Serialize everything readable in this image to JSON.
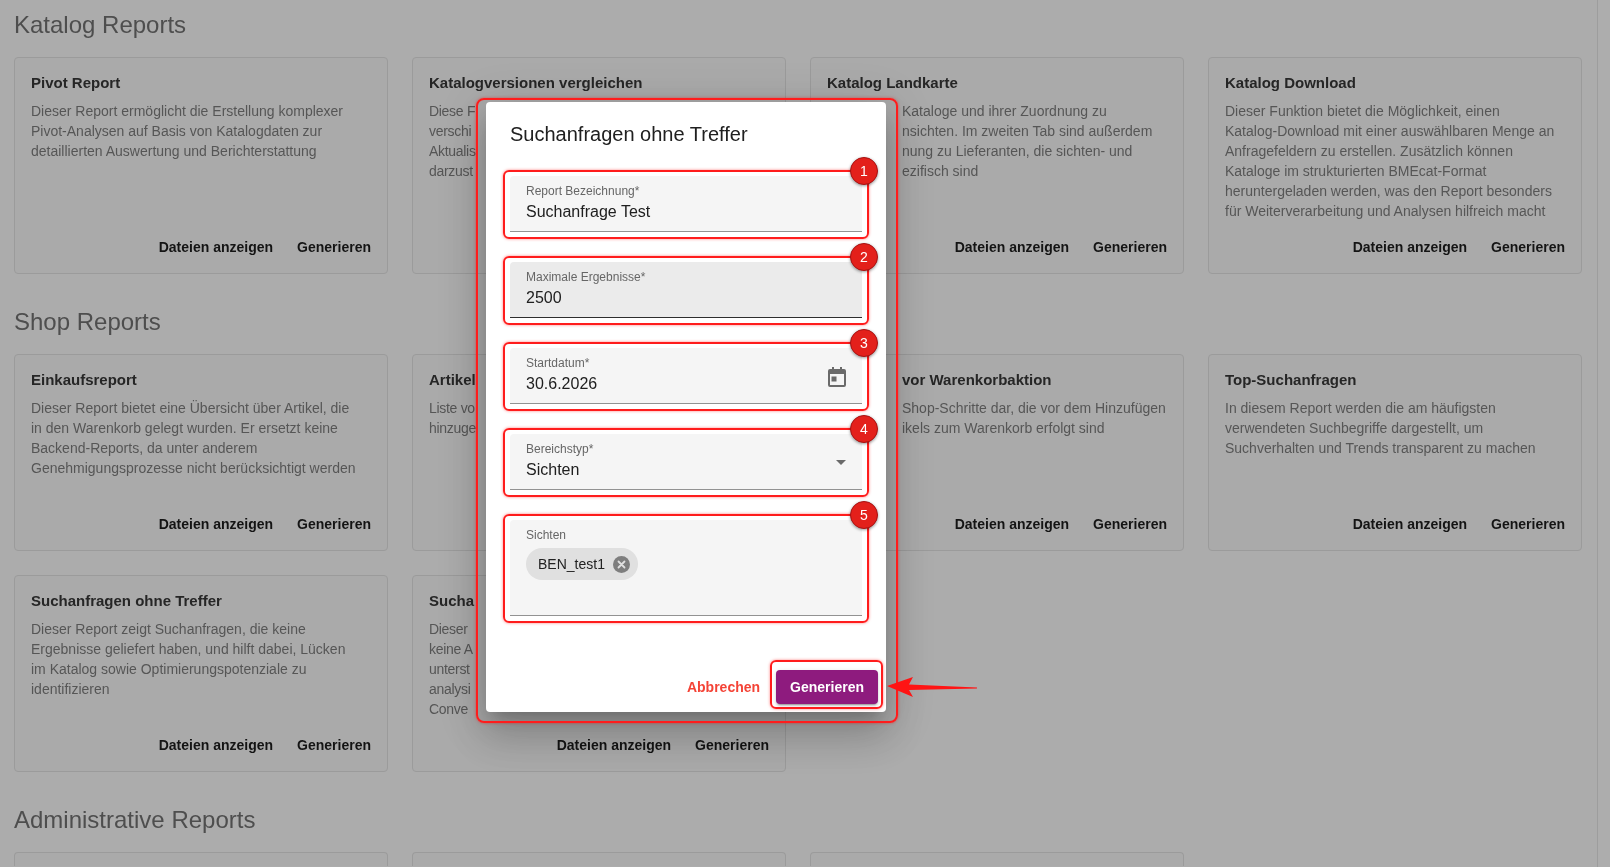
{
  "sections": [
    {
      "title": "Katalog Reports",
      "cards": [
        {
          "kind": "full",
          "title": "Pivot Report",
          "description": "Dieser Report ermöglicht die Erstellung komplexer Pivot-Analysen auf Basis von Katalogdaten zur detaillierten Auswertung und Berichterstattung",
          "actions": [
            "Dateien anzeigen",
            "Generieren"
          ]
        },
        {
          "kind": "hidden_right",
          "title": "Katalogversionen vergleichen",
          "description_lines": [
            "Diese F",
            "verschi",
            "Aktualis",
            "darzust"
          ]
        },
        {
          "kind": "hidden_left",
          "title": "Katalog Landkarte",
          "title_cut": false,
          "description_lines": [
            "Kataloge und ihrer Zuordnung zu",
            "nsichten. Im zweiten Tab sind außerdem",
            "nung zu Lieferanten, die sichten- und",
            "ezifisch sind"
          ],
          "actions": [
            "Dateien anzeigen",
            "Generieren"
          ]
        },
        {
          "kind": "full",
          "title": "Katalog Download",
          "description": "Dieser Funktion bietet die Möglichkeit, einen Katalog-Download mit einer auswählbaren Menge an Anfragefeldern zu erstellen. Zusätzlich können Kataloge im strukturierten BMEcat-Format heruntergeladen werden, was den Report besonders für Weiterverarbeitung und Analysen hilfreich macht",
          "actions": [
            "Dateien anzeigen",
            "Generieren"
          ]
        }
      ]
    },
    {
      "title": "Shop Reports",
      "cards": [
        {
          "kind": "full",
          "title": "Einkaufsreport",
          "description": "Dieser Report bietet eine Übersicht über Artikel, die in den Warenkorb gelegt wurden. Er ersetzt keine Backend-Reports, da unter anderem Genehmigungsprozesse nicht berücksichtigt werden",
          "actions": [
            "Dateien anzeigen",
            "Generieren"
          ]
        },
        {
          "kind": "hidden_right",
          "title": "Artikel",
          "description_lines": [
            "Liste vo",
            "hinzuge"
          ]
        },
        {
          "kind": "hidden_left",
          "title": "vor Warenkorbaktion",
          "title_cut": true,
          "description_lines": [
            "Shop-Schritte dar, die vor dem Hinzufügen",
            "ikels zum Warenkorb erfolgt sind"
          ],
          "actions": [
            "Dateien anzeigen",
            "Generieren"
          ]
        },
        {
          "kind": "full",
          "title": "Top-Suchanfragen",
          "description": "In diesem Report werden die am häufigsten verwendeten Suchbegriffe dargestellt, um Suchverhalten und Trends transparent zu machen",
          "actions": [
            "Dateien anzeigen",
            "Generieren"
          ]
        },
        {
          "kind": "full",
          "title": "Suchanfragen ohne Treffer",
          "description": "Dieser Report zeigt Suchanfragen, die keine Ergebnisse geliefert haben, und hilft dabei, Lücken im Katalog sowie Optimierungspotenziale zu identifizieren",
          "actions": [
            "Dateien anzeigen",
            "Generieren"
          ]
        },
        {
          "kind": "hidden_right",
          "title": "Sucha",
          "description_lines": [
            "Dieser",
            "keine A",
            "unterst",
            "analysi",
            "Conve"
          ],
          "actions": [
            "Dateien anzeigen",
            "Generieren"
          ]
        }
      ]
    },
    {
      "title": "Administrative Reports",
      "cards": [
        {
          "kind": "cut_off"
        },
        {
          "kind": "cut_off"
        },
        {
          "kind": "cut_off"
        }
      ]
    }
  ],
  "dialog": {
    "title": "Suchanfragen ohne Treffer",
    "annotated": true,
    "fields": [
      {
        "kind": "text",
        "label": "Report Bezeichnung*",
        "value": "Suchanfrage Test",
        "hovered": false,
        "callout": "1"
      },
      {
        "kind": "text",
        "label": "Maximale Ergebnisse*",
        "value": "2500",
        "hovered": true,
        "callout": "2"
      },
      {
        "kind": "date",
        "label": "Startdatum*",
        "value": "30.6.2026",
        "hovered": false,
        "callout": "3"
      },
      {
        "kind": "select",
        "label": "Bereichstyp*",
        "value": "Sichten",
        "hovered": false,
        "callout": "4"
      },
      {
        "kind": "chips",
        "label": "Sichten",
        "chips": [
          "BEN_test1"
        ],
        "hovered": false,
        "callout": "5"
      }
    ],
    "actions": [
      {
        "kind": "text",
        "label": "Abbrechen",
        "annotated": false
      },
      {
        "kind": "contained",
        "label": "Generieren",
        "annotated": true
      }
    ]
  }
}
